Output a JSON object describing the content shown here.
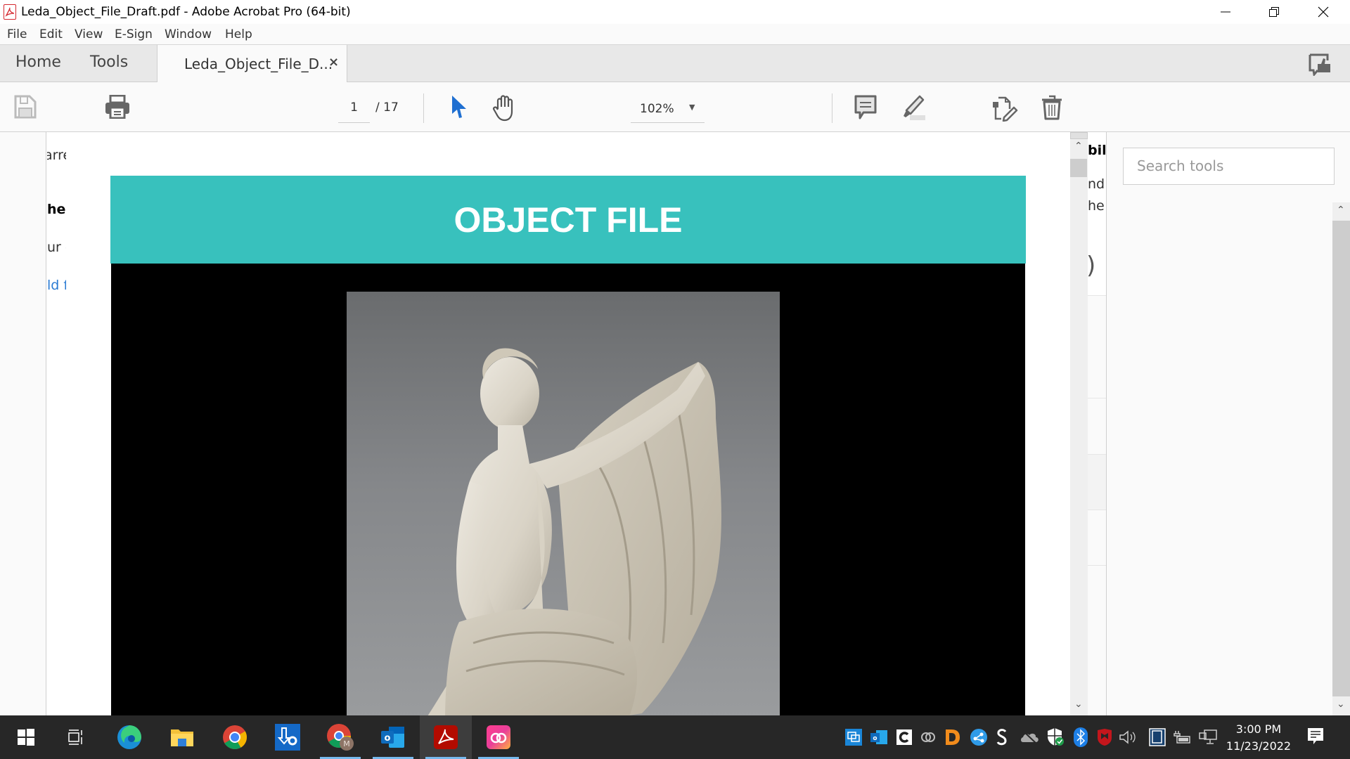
{
  "window": {
    "title": "Leda_Object_File_Draft.pdf - Adobe Acrobat Pro (64-bit)",
    "controls": [
      "minimize",
      "restore",
      "close"
    ]
  },
  "menu": [
    "File",
    "Edit",
    "View",
    "E-Sign",
    "Window",
    "Help"
  ],
  "tabs": {
    "home": "Home",
    "tools": "Tools",
    "document": "Leda_Object_File_D...",
    "document_close": "×"
  },
  "toolbar": {
    "current_page": "1",
    "total_pages": "/ 17",
    "zoom": "102%",
    "icons": [
      "save-icon",
      "print-icon",
      "select-cursor-icon",
      "hand-icon",
      "comment-icon",
      "highlight-icon",
      "edit-file-icon",
      "delete-icon"
    ]
  },
  "left_fragments": [
    "arre",
    "her",
    "ur c",
    "ld f"
  ],
  "document": {
    "banner_title": "OBJECT FILE",
    "banner_color": "#38c1bd",
    "image_subject": "Marble statue of Leda and the Swan"
  },
  "right_fragments": [
    "bil",
    "nd",
    "he",
    ")"
  ],
  "right_pane": {
    "search_placeholder": "Search tools"
  },
  "taskbar": {
    "apps": [
      "start",
      "task-view",
      "edge",
      "file-explorer",
      "chrome",
      "software-center",
      "chrome-profile-m",
      "outlook",
      "acrobat",
      "creative-cloud"
    ],
    "profile_badge": "M",
    "time": "3:00 PM",
    "date": "11/23/2022"
  }
}
